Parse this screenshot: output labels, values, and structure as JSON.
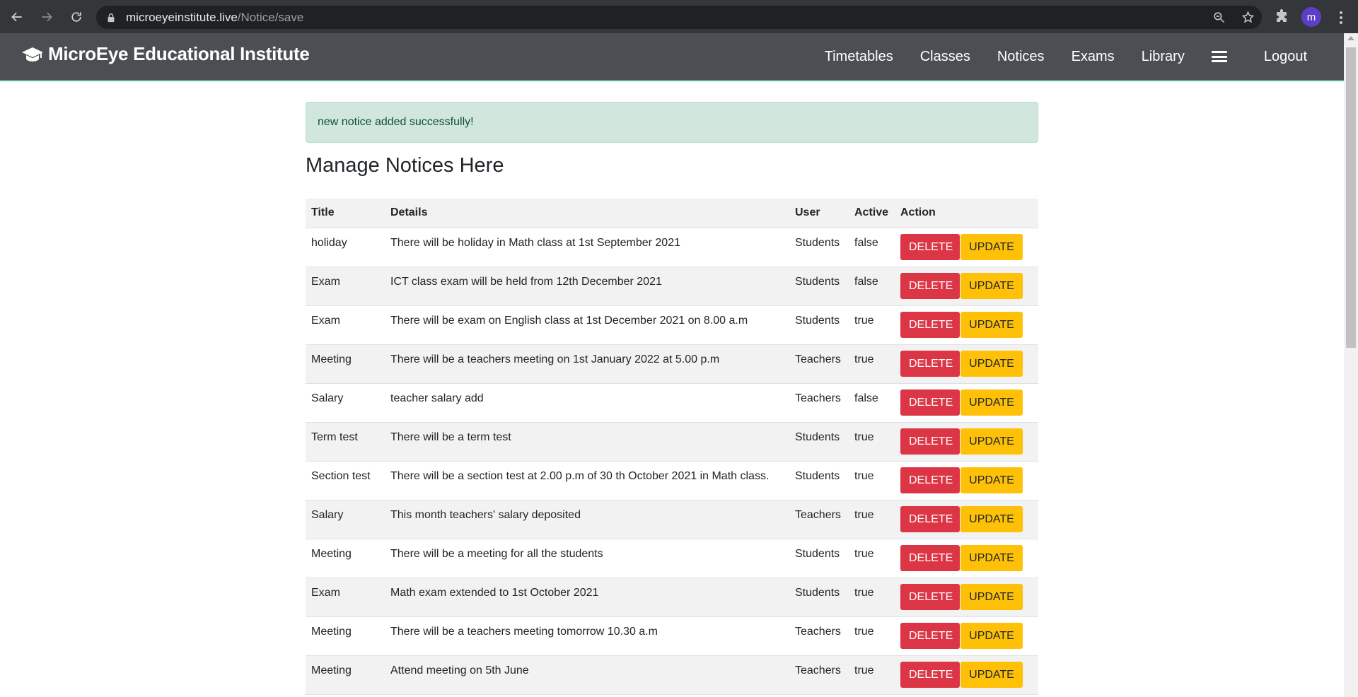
{
  "browser": {
    "url_host": "microeyeinstitute.live",
    "url_path": "/Notice/save",
    "profile_initial": "m"
  },
  "navbar": {
    "brand": "MicroEye Educational Institute",
    "brand_icon": "graduation-cap-icon",
    "links": [
      "Timetables",
      "Classes",
      "Notices",
      "Exams",
      "Library"
    ],
    "logout": "Logout"
  },
  "alert": {
    "message": "new notice added successfully!"
  },
  "page": {
    "title": "Manage Notices Here"
  },
  "table": {
    "headers": [
      "Title",
      "Details",
      "User",
      "Active",
      "Action"
    ],
    "delete_label": "DELETE",
    "update_label": "UPDATE",
    "rows": [
      {
        "title": "holiday",
        "details": "There will be holiday in Math class at 1st September 2021",
        "user": "Students",
        "active": "false"
      },
      {
        "title": "Exam",
        "details": "ICT class exam will be held from 12th December 2021",
        "user": "Students",
        "active": "false"
      },
      {
        "title": "Exam",
        "details": "There will be exam on English class at 1st December 2021 on 8.00 a.m",
        "user": "Students",
        "active": "true"
      },
      {
        "title": "Meeting",
        "details": "There will be a teachers meeting on 1st January 2022 at 5.00 p.m",
        "user": "Teachers",
        "active": "true"
      },
      {
        "title": "Salary",
        "details": "teacher salary add",
        "user": "Teachers",
        "active": "false"
      },
      {
        "title": "Term test",
        "details": "There will be a term test",
        "user": "Students",
        "active": "true"
      },
      {
        "title": "Section test",
        "details": "There will be a section test at 2.00 p.m of 30 th October 2021 in Math class.",
        "user": "Students",
        "active": "true"
      },
      {
        "title": "Salary",
        "details": "This month teachers' salary deposited",
        "user": "Teachers",
        "active": "true"
      },
      {
        "title": "Meeting",
        "details": "There will be a meeting for all the students",
        "user": "Students",
        "active": "true"
      },
      {
        "title": "Exam",
        "details": "Math exam extended to 1st October 2021",
        "user": "Students",
        "active": "true"
      },
      {
        "title": "Meeting",
        "details": "There will be a teachers meeting tomorrow 10.30 a.m",
        "user": "Teachers",
        "active": "true"
      },
      {
        "title": "Meeting",
        "details": "Attend meeting on 5th June",
        "user": "Teachers",
        "active": "true"
      }
    ]
  },
  "colors": {
    "navbar_bg": "#4b4f54",
    "navbar_accent": "#4fb69a",
    "alert_bg": "#d1e7dd",
    "alert_text": "#0f5132",
    "delete_bg": "#dc3545",
    "update_bg": "#ffc107"
  }
}
